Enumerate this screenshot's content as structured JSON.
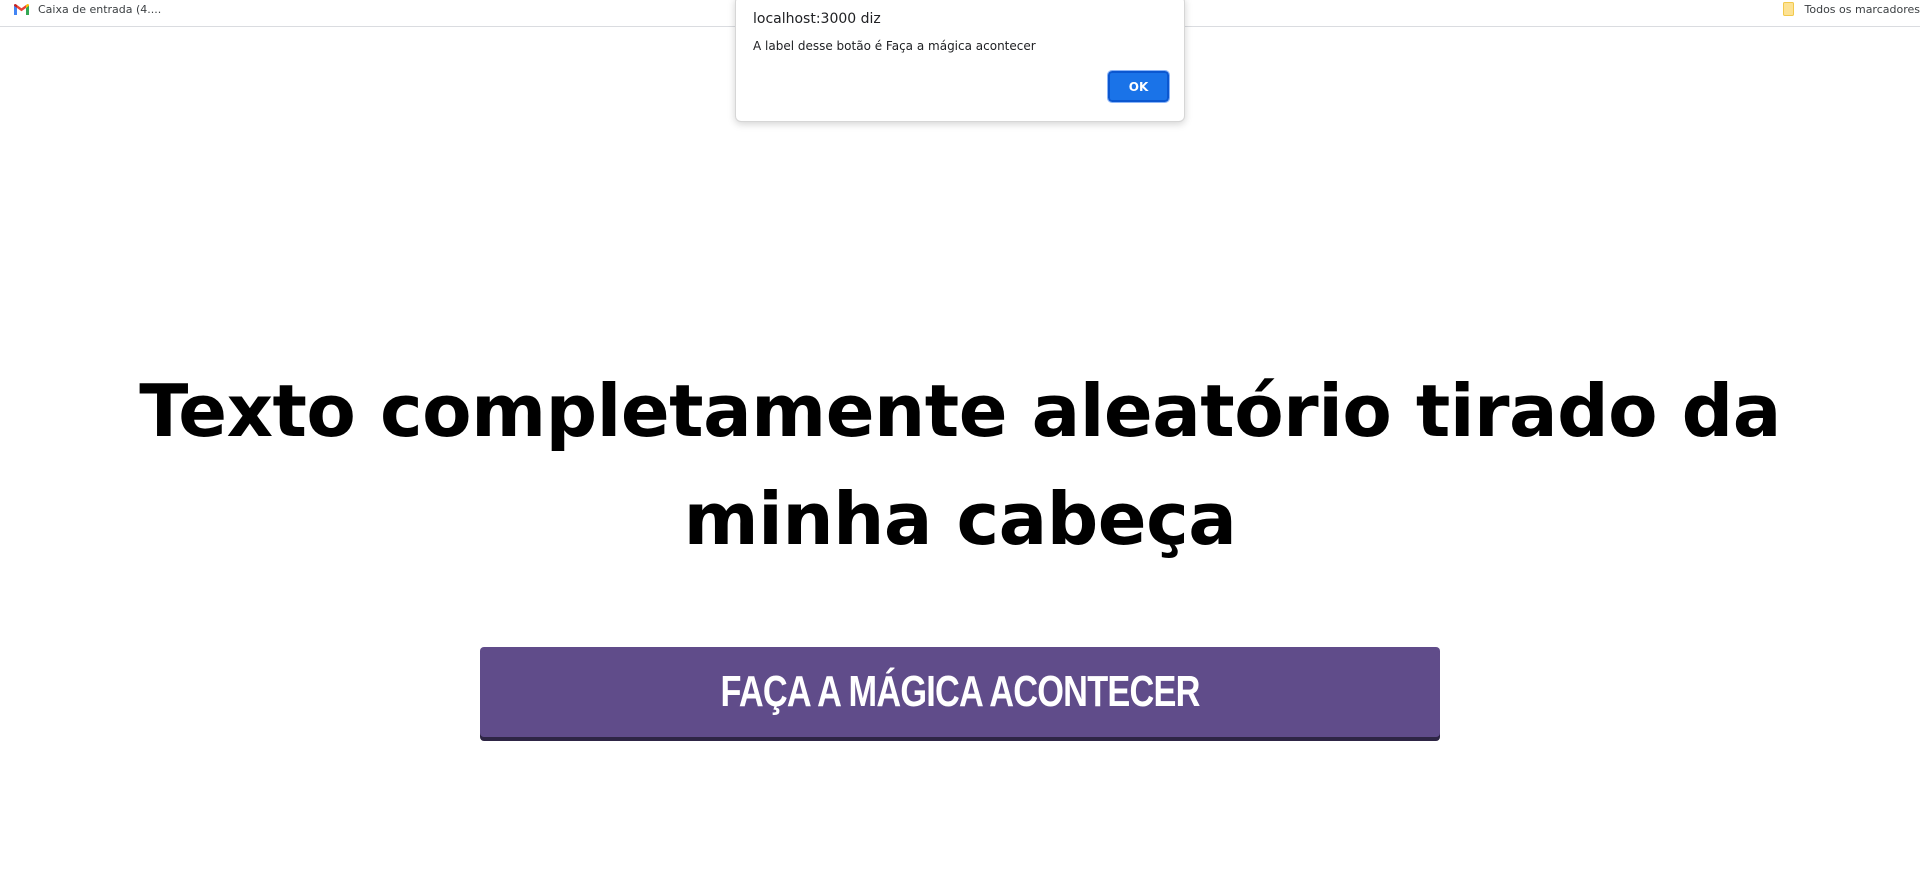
{
  "bookmarks_bar": {
    "gmail_label": "Caixa de entrada (4....",
    "all_bookmarks_label": "Todos os marcadores"
  },
  "main": {
    "headline": "Texto completamente aleatório tirado da minha cabeça",
    "button_label": "Faça a mágica acontecer",
    "button_color": "#604c8a"
  },
  "alert": {
    "title": "localhost:3000 diz",
    "message": "A label desse botão é Faça a mágica acontecer",
    "ok_label": "OK",
    "ok_color": "#1a73e8"
  }
}
